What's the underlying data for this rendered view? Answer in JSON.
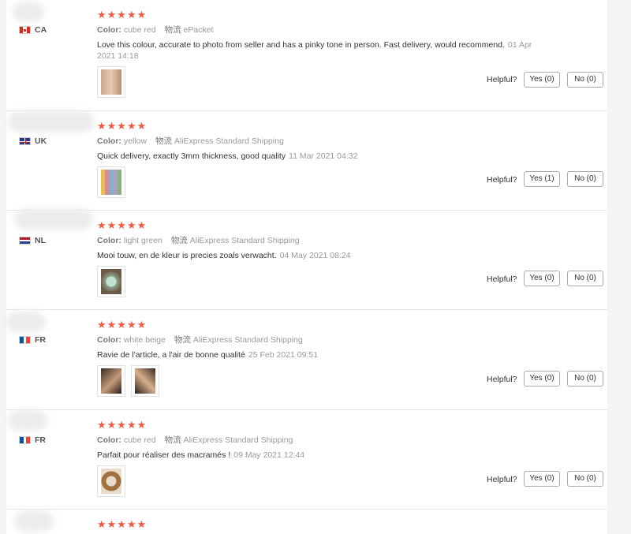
{
  "reviews": [
    {
      "country": "CA",
      "stars": "★★★★★",
      "color_label": "Color:",
      "color": "cube red",
      "ship_label": "物流",
      "shipping": "ePacket",
      "text": "Love this colour, accurate to photo from seller and has a pinky tone in person. Fast delivery, would recommend.",
      "date": "01 Apr 2021 14:18",
      "helpful": "Helpful?",
      "yes": "Yes (0)",
      "no": "No (0)"
    },
    {
      "country": "UK",
      "stars": "★★★★★",
      "color_label": "Color:",
      "color": "yellow",
      "ship_label": "物流",
      "shipping": "AliExpress Standard Shipping",
      "text": "Quick delivery, exactly 3mm thickness, good quality",
      "date": "11 Mar 2021 04:32",
      "helpful": "Helpful?",
      "yes": "Yes (1)",
      "no": "No (0)"
    },
    {
      "country": "NL",
      "stars": "★★★★★",
      "color_label": "Color:",
      "color": "light green",
      "ship_label": "物流",
      "shipping": "AliExpress Standard Shipping",
      "text": "Mooi touw, en de kleur is precies zoals verwacht.",
      "date": "04 May 2021 08:24",
      "helpful": "Helpful?",
      "yes": "Yes (0)",
      "no": "No (0)"
    },
    {
      "country": "FR",
      "stars": "★★★★★",
      "color_label": "Color:",
      "color": "white beige",
      "ship_label": "物流",
      "shipping": "AliExpress Standard Shipping",
      "text": "Ravie de l'article, a l'air de bonne qualité",
      "date": "25 Feb 2021 09:51",
      "helpful": "Helpful?",
      "yes": "Yes (0)",
      "no": "No (0)"
    },
    {
      "country": "FR",
      "stars": "★★★★★",
      "color_label": "Color:",
      "color": "cube red",
      "ship_label": "物流",
      "shipping": "AliExpress Standard Shipping",
      "text": "Parfait pour réaliser des macramés !",
      "date": "09 May 2021 12:44",
      "helpful": "Helpful?",
      "yes": "Yes (0)",
      "no": "No (0)"
    },
    {
      "stars": "★★★★★"
    }
  ],
  "colors": {
    "star": "#f05a41",
    "muted": "#999999",
    "border": "#e6e6e6"
  }
}
